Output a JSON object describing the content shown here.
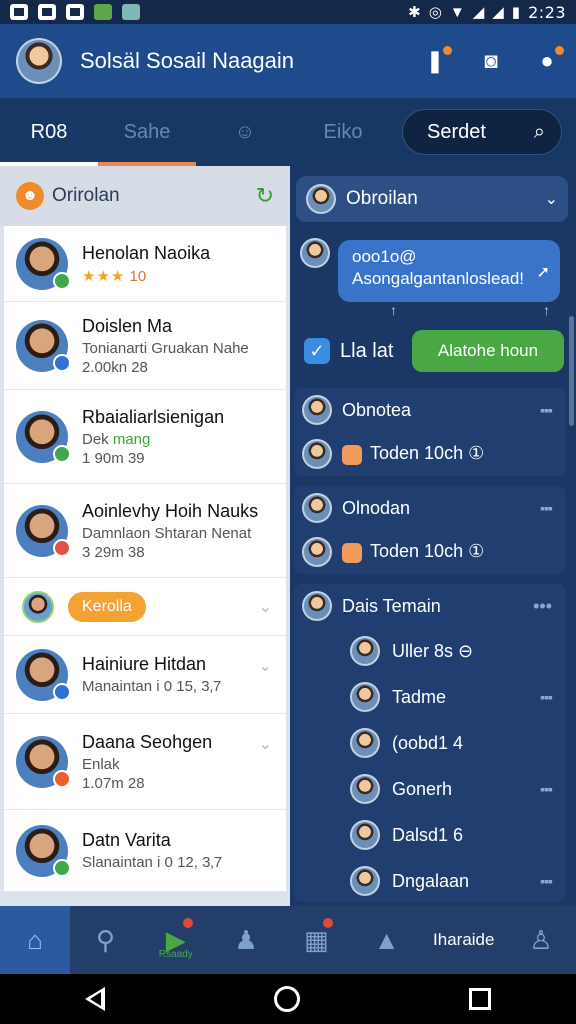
{
  "status_bar": {
    "time": "2:23",
    "icons": [
      "mail-icon",
      "chrome-icon",
      "photo-icon",
      "game-icon",
      "gallery-icon",
      "bluetooth-icon",
      "alarm-icon",
      "wifi-icon",
      "signal-icon",
      "signal-icon",
      "battery-icon"
    ]
  },
  "app_bar": {
    "title": "Solsäl Sosail Naagain"
  },
  "tabs": [
    {
      "label": "R08"
    },
    {
      "label": "Sahe"
    },
    {
      "label": "Eiko"
    }
  ],
  "search": {
    "label": "Serdet"
  },
  "left": {
    "header_label": "Orirolan",
    "contacts": [
      {
        "name": "Henolan Naoika",
        "stars": "★★★",
        "rating": "10"
      },
      {
        "name": "Doislen Ma",
        "line1": "Tonianarti Gruakan Nahe",
        "line2": "2.00kn  28"
      },
      {
        "name": "Rbaialiarlsienigan",
        "line1_a": "Dek ",
        "line1_b": "mang",
        "line2": "1 90m  39"
      },
      {
        "name": "Aoinlevhy Hoih Nauks",
        "line1": "Damnlaon Shtaran Nenat",
        "line2": "3 29m  38"
      }
    ],
    "section_pill": "Kerolla",
    "contacts2": [
      {
        "name": "Hainiure Hitdan",
        "line1": "Manaintan i 0 15, 3‚7"
      },
      {
        "name": "Daana Seohgen",
        "line1": "Enlak",
        "line2": "1.07m  28"
      },
      {
        "name": "Datn Varita",
        "line1": "Slanaintan i 0 12, 3‚7"
      }
    ]
  },
  "right": {
    "header_label": "Obroilan",
    "bubble_line1": "ooo1o@",
    "bubble_line2": "Asongalgantanloslead!",
    "action_label": "Lla lat",
    "action_button": "Alatohe houn",
    "card1": {
      "title": "Obnotea",
      "item": "Toden 10ch ①"
    },
    "card2": {
      "title": "Olnodan",
      "item": "Toden 10ch ①"
    },
    "card3": {
      "title": "Dais Temain",
      "items": [
        "Uller 8s ⊖",
        "Tadme",
        "(oobd1 4",
        "Gonerh",
        "Dalsd1 6",
        "Dngalaan"
      ]
    }
  },
  "bottom_nav": {
    "tiny_label": "Rsaady",
    "text_item": "Iharaide"
  }
}
